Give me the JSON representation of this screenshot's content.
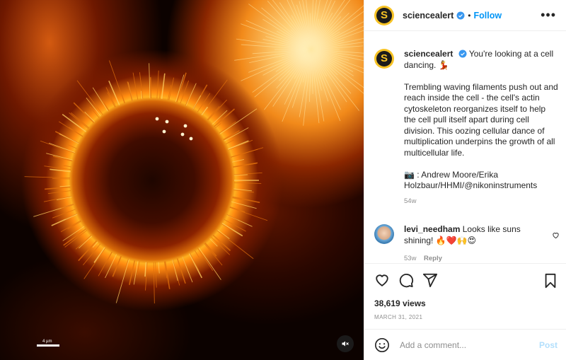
{
  "colors": {
    "accent": "#0095f6",
    "avatar_bg": "#f7c325",
    "muted": "#8e8e8e",
    "post_disabled": "#b2dffc"
  },
  "media": {
    "scale_label": "4 µm",
    "mute_icon": "speaker-muted-icon"
  },
  "header": {
    "avatar_letter": "S",
    "username": "sciencealert",
    "separator": "•",
    "follow_label": "Follow",
    "more_label": "•••"
  },
  "caption": {
    "avatar_letter": "S",
    "username": "sciencealert",
    "lead": "You're looking at a cell dancing. 💃",
    "paragraph": "Trembling waving filaments push out and reach inside the cell - the cell's actin cytoskeleton reorganizes itself to help the cell pull itself apart during cell division. This oozing cellular dance of multiplication underpins the growth of all multicellular life.",
    "credit": "📷 : Andrew Moore/Erika Holzbaur/HHMI/@nikoninstruments",
    "time": "54w"
  },
  "comment": {
    "username": "levi_needham",
    "text": "Looks like suns shining! 🔥❤️🙌😍",
    "time": "53w",
    "reply_label": "Reply"
  },
  "actions": {
    "views": "38,619 views",
    "date": "MARCH 31, 2021"
  },
  "add_comment": {
    "placeholder": "Add a comment...",
    "post_label": "Post"
  }
}
